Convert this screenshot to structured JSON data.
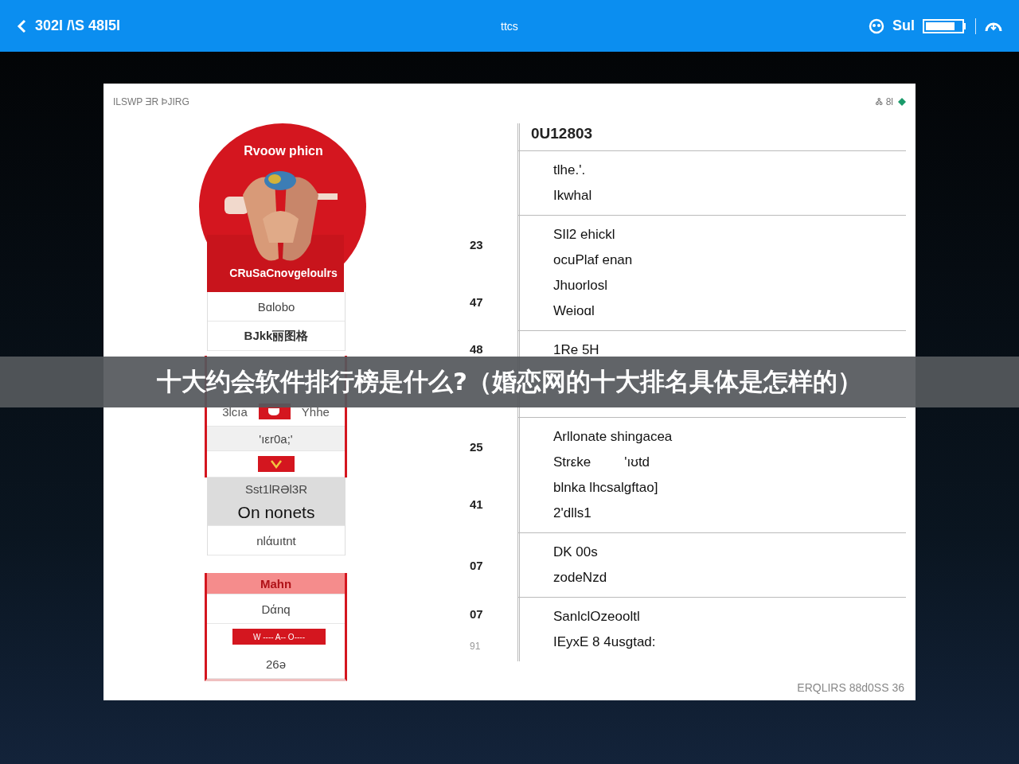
{
  "status_bar": {
    "time": "302l /\\S 48l5l",
    "title": "ttcs",
    "carrier": "Sul"
  },
  "panel": {
    "header": "ILSWP ƎR ÞJIRG",
    "header_right": "Ꮬ 8l",
    "footer": "ERQLIRS 88d0SS 36"
  },
  "poster": {
    "title": "Rvoow phicn",
    "caption": "CRuSaCnovgeloulrs"
  },
  "menu": [
    {
      "kind": "plain",
      "items": [
        {
          "kind": "item",
          "label": "Bɑlobo"
        },
        {
          "kind": "strong",
          "label": "BJkk丽图格"
        }
      ]
    },
    {
      "kind": "framed",
      "items": [
        {
          "kind": "pair",
          "label": "3lcıa",
          "label_2": "Yhhe"
        },
        {
          "kind": "shaded",
          "label": "'ıεr0a;'"
        },
        {
          "kind": "badge"
        }
      ]
    },
    {
      "kind": "plain",
      "items": [
        {
          "kind": "grey",
          "label": "Sst1lRƏl3R"
        },
        {
          "kind": "grey-large",
          "label": "On nonets"
        },
        {
          "kind": "item",
          "label": "nlάuıtnt"
        }
      ]
    },
    {
      "kind": "framed",
      "items": [
        {
          "kind": "pink-header",
          "label": "Mahn"
        },
        {
          "kind": "item",
          "label": "Dάnq"
        },
        {
          "kind": "red-bar",
          "label": "W ---- A-- O----"
        },
        {
          "kind": "item",
          "label": "26ǝ"
        }
      ]
    }
  ],
  "table": {
    "header": "0U12803",
    "rows": [
      {
        "numbers": [],
        "lines": [
          [
            "tlhe.'."
          ],
          [
            "Ikwhal"
          ]
        ]
      },
      {
        "numbers": [
          "23",
          "47"
        ],
        "lines": [
          [
            "SIl2 ehickl"
          ],
          [
            "ocuPlaf enan"
          ],
          [
            "Jhuorlosl"
          ],
          [
            "Weioɑl"
          ]
        ]
      },
      {
        "numbers": [
          "48"
        ],
        "lines": [
          [
            "1Re 5H"
          ]
        ]
      },
      {
        "numbers": [
          "25",
          "41"
        ],
        "lines": [
          [
            "Arllonate shingacea"
          ],
          [
            "Strεke",
            "'ıʊtd"
          ],
          [
            "blnka lhcsalgftao]"
          ],
          [
            "2'dlls1"
          ]
        ]
      },
      {
        "numbers": [
          "07"
        ],
        "lines": [
          [
            "DK 00s"
          ],
          [
            "zodeNzd"
          ]
        ]
      },
      {
        "numbers": [
          "07",
          "91"
        ],
        "lines": [
          [
            "SanlclOzeooltl"
          ],
          [
            "IEyxE 8 4usgtad:"
          ]
        ]
      }
    ]
  },
  "caption": "十大约会软件排行榜是什么?（婚恋网的十大排名具体是怎样的）"
}
